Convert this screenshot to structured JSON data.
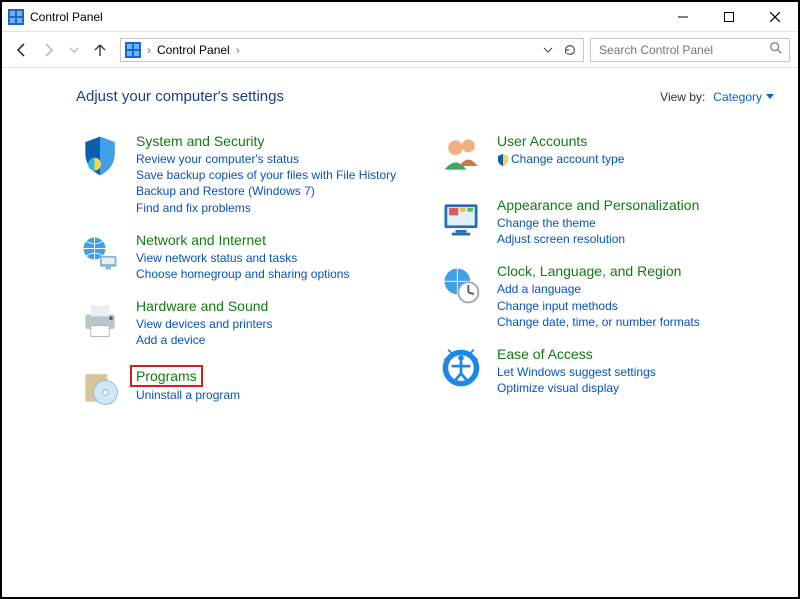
{
  "window": {
    "title": "Control Panel"
  },
  "address": {
    "crumb": "Control Panel"
  },
  "search": {
    "placeholder": "Search Control Panel"
  },
  "heading": "Adjust your computer's settings",
  "viewby": {
    "label": "View by:",
    "value": "Category"
  },
  "left": [
    {
      "key": "system-security",
      "title": "System and Security",
      "links": [
        "Review your computer's status",
        "Save backup copies of your files with File History",
        "Backup and Restore (Windows 7)",
        "Find and fix problems"
      ]
    },
    {
      "key": "network-internet",
      "title": "Network and Internet",
      "links": [
        "View network status and tasks",
        "Choose homegroup and sharing options"
      ]
    },
    {
      "key": "hardware-sound",
      "title": "Hardware and Sound",
      "links": [
        "View devices and printers",
        "Add a device"
      ]
    },
    {
      "key": "programs",
      "title": "Programs",
      "links": [
        "Uninstall a program"
      ],
      "highlight": true
    }
  ],
  "right": [
    {
      "key": "user-accounts",
      "title": "User Accounts",
      "links": [
        "Change account type"
      ],
      "shield": true
    },
    {
      "key": "appearance",
      "title": "Appearance and Personalization",
      "links": [
        "Change the theme",
        "Adjust screen resolution"
      ]
    },
    {
      "key": "clock-lang-region",
      "title": "Clock, Language, and Region",
      "links": [
        "Add a language",
        "Change input methods",
        "Change date, time, or number formats"
      ]
    },
    {
      "key": "ease-of-access",
      "title": "Ease of Access",
      "links": [
        "Let Windows suggest settings",
        "Optimize visual display"
      ]
    }
  ]
}
